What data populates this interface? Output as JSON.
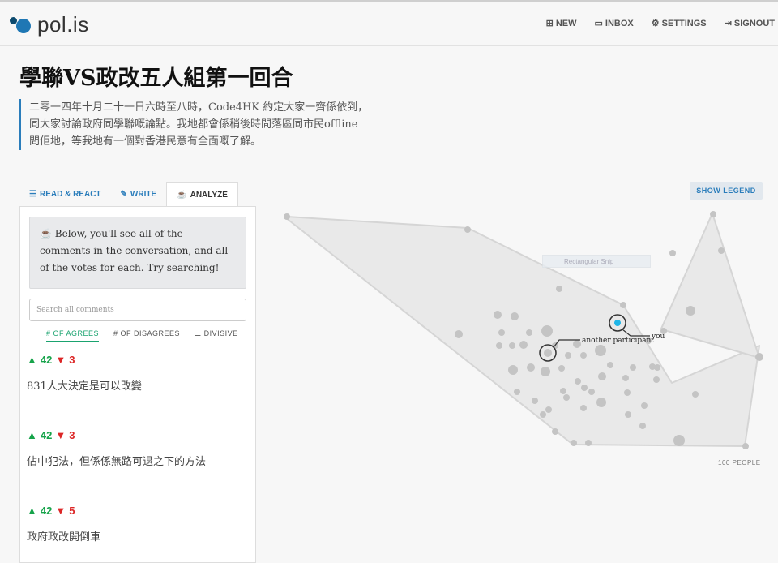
{
  "app": {
    "logo_text": "pol.is"
  },
  "nav": [
    {
      "icon": "plus-square-icon",
      "label": "NEW"
    },
    {
      "icon": "inbox-icon",
      "label": "INBOX"
    },
    {
      "icon": "gear-icon",
      "label": "SETTINGS"
    },
    {
      "icon": "signout-icon",
      "label": "SIGNOUT"
    }
  ],
  "conversation": {
    "title": "學聯VS政改五人組第一回合",
    "description_lines": [
      "二零一四年十月二十一日六時至八時，Code4HK 約定大家一齊係依到，",
      "同大家討論政府同學聯嘅論點。我地都會係稍後時間落區同市民offline",
      "問佢地，等我地有一個對香港民意有全面嘅了解。"
    ]
  },
  "tabs": [
    {
      "icon": "list-icon",
      "label": "READ & REACT",
      "active": false
    },
    {
      "icon": "pencil-icon",
      "label": "WRITE",
      "active": false
    },
    {
      "icon": "coffee-icon",
      "label": "ANALYZE",
      "active": true
    }
  ],
  "analyze": {
    "info_text": "Below, you'll see all of the comments in the conversation, and all of the votes for each. Try searching!",
    "search_placeholder": "Search all comments",
    "sort_options": [
      {
        "label": "# OF AGREES",
        "active": true
      },
      {
        "label": "# OF DISAGREES",
        "active": false
      },
      {
        "label": "DIVISIVE",
        "active": false
      }
    ],
    "comments": [
      {
        "agrees": "42",
        "disagrees": "3",
        "text": "831人大決定是可以改變"
      },
      {
        "agrees": "42",
        "disagrees": "3",
        "text": "佔中犯法，但係係無路可退之下的方法"
      },
      {
        "agrees": "42",
        "disagrees": "5",
        "text": "政府政改開倒車"
      }
    ]
  },
  "legend_button": "SHOW LEGEND",
  "viz": {
    "you_label": "you",
    "participant_label": "another participant",
    "people_count": "100 PEOPLE",
    "overlay_text": "Rectangular Snip"
  },
  "colors": {
    "accent": "#2a7dbb",
    "agree": "#16a34a",
    "disagree": "#dc2626",
    "you": "#1fb6e8"
  }
}
